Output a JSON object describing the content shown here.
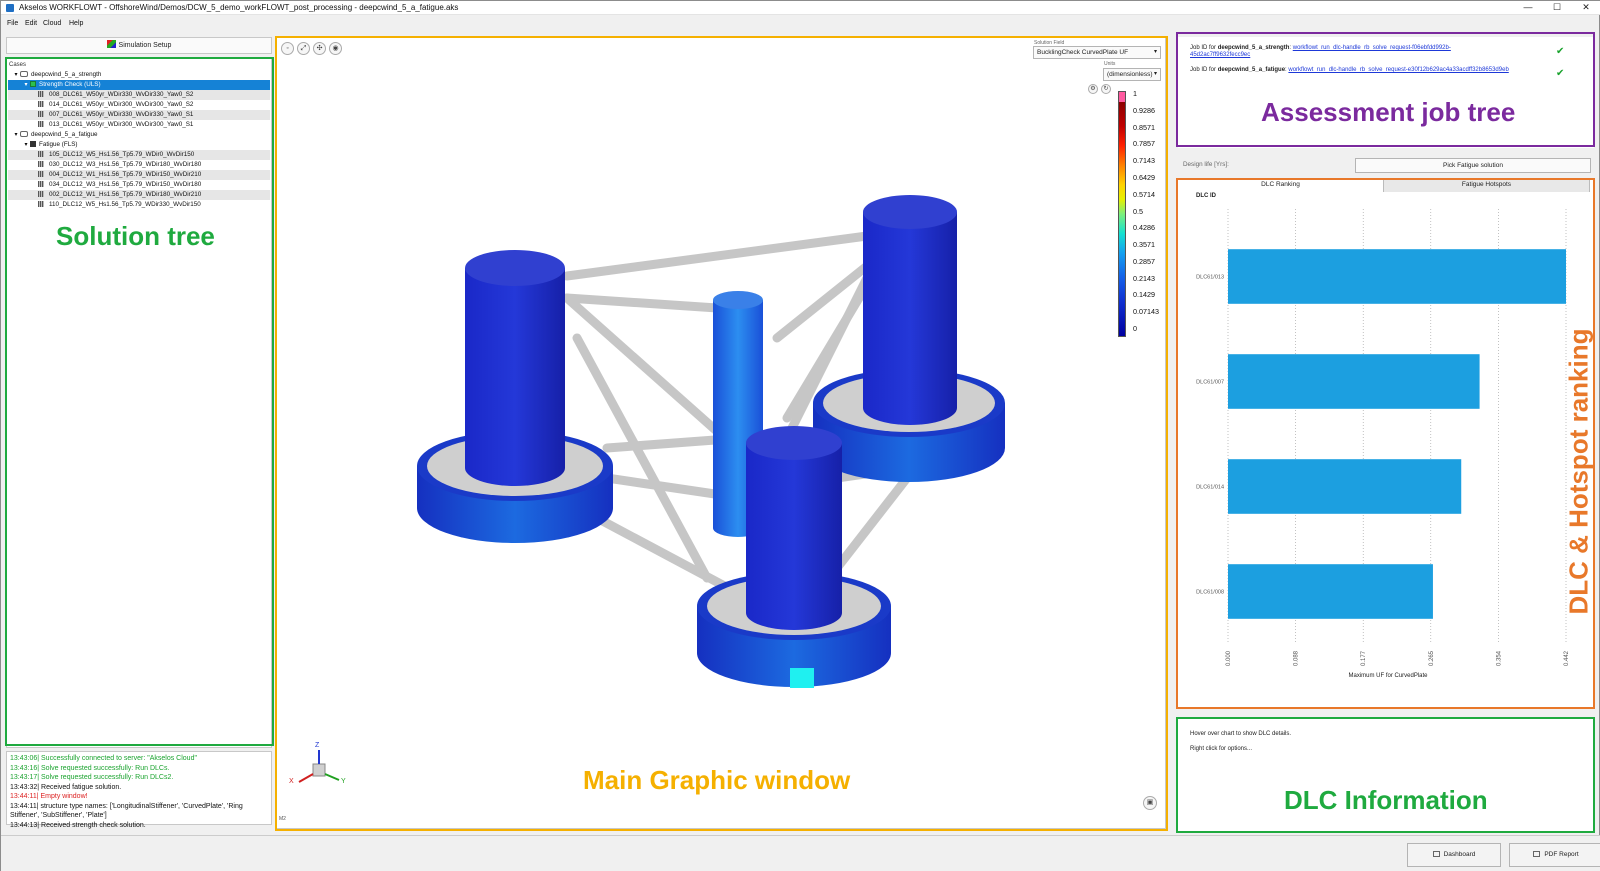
{
  "window": {
    "title": "Akselos WORKFLOWT - OffshoreWind/Demos/DCW_5_demo_workFLOWT_post_processing - deepcwind_5_a_fatigue.aks",
    "controls": [
      "—",
      "☐",
      "✕"
    ]
  },
  "menu": [
    "File",
    "Edit",
    "Cloud",
    "Help"
  ],
  "left": {
    "sim_setup_label": "Simulation Setup",
    "cases_header": "Cases",
    "tree": [
      {
        "label": "deepcwind_5_a_strength",
        "kind": "case",
        "expanded": true
      },
      {
        "label": "Strength Check (ULS)",
        "kind": "check",
        "selected": true
      },
      {
        "label": "008_DLC61_W50yr_WDir330_WvDir330_Yaw0_S2",
        "kind": "dlc"
      },
      {
        "label": "014_DLC61_W50yr_WDir300_WvDir300_Yaw0_S2",
        "kind": "dlc"
      },
      {
        "label": "007_DLC61_W50yr_WDir330_WvDir330_Yaw0_S1",
        "kind": "dlc"
      },
      {
        "label": "013_DLC61_W50yr_WDir300_WvDir300_Yaw0_S1",
        "kind": "dlc"
      },
      {
        "label": "deepcwind_5_a_fatigue",
        "kind": "case",
        "expanded": true
      },
      {
        "label": "Fatigue (FLS)",
        "kind": "fatigue"
      },
      {
        "label": "105_DLC12_W5_Hs1.56_Tp5.79_WDir0_WvDir150",
        "kind": "dlc"
      },
      {
        "label": "030_DLC12_W3_Hs1.56_Tp5.79_WDir180_WvDir180",
        "kind": "dlc"
      },
      {
        "label": "004_DLC12_W1_Hs1.56_Tp5.79_WDir150_WvDir210",
        "kind": "dlc"
      },
      {
        "label": "034_DLC12_W3_Hs1.56_Tp5.79_WDir150_WvDir180",
        "kind": "dlc"
      },
      {
        "label": "002_DLC12_W1_Hs1.56_Tp5.79_WDir180_WvDir210",
        "kind": "dlc"
      },
      {
        "label": "110_DLC12_W5_Hs1.56_Tp5.79_WDir330_WvDir150",
        "kind": "dlc"
      }
    ],
    "overlay_label": "Solution tree"
  },
  "log": [
    {
      "text": "13:43:06| Successfully connected to server: \"Akselos Cloud\"",
      "level": "ok"
    },
    {
      "text": "13:43:16| Solve requested successfully: Run DLCs.",
      "level": "ok"
    },
    {
      "text": "13:43:17| Solve requested successfully: Run DLCs2.",
      "level": "ok"
    },
    {
      "text": "13:43:32| Received fatigue solution.",
      "level": "info"
    },
    {
      "text": "13:44:11| Empty window!",
      "level": "err"
    },
    {
      "text": "13:44:11| structure type names: ['LongitudinalStiffener', 'CurvedPlate', 'Ring Stiffener', 'SubStiffener', 'Plate']",
      "level": "info"
    },
    {
      "text": "13:44:13| Received strength check solution.",
      "level": "info"
    }
  ],
  "viewport": {
    "solution_field_label": "Solution Field",
    "solution_field_value": "BucklingCheck CurvedPlate UF",
    "units_label": "Units",
    "units_value": "(dimensionless)",
    "colorbar_labels": [
      "1",
      "0.9286",
      "0.8571",
      "0.7857",
      "0.7143",
      "0.6429",
      "0.5714",
      "0.5",
      "0.4286",
      "0.3571",
      "0.2857",
      "0.2143",
      "0.1429",
      "0.07143",
      "0"
    ],
    "overlay_label": "Main Graphic window",
    "axes": {
      "x": "X",
      "y": "Y",
      "z": "Z"
    },
    "corner_text": "M2"
  },
  "jobs": {
    "lines": [
      {
        "prefix": "Job ID for ",
        "name": "deepcwind_5_a_strength",
        "sep": ": ",
        "link": "workflowt_run_dlc-handle_rb_solve_request-f06ebfdd992b-45d2ac7ff9632fecc9ec",
        "done": "✔"
      },
      {
        "prefix": "Job ID for ",
        "name": "deepcwind_5_a_fatigue",
        "sep": ": ",
        "link": "workflowt_run_dlc-handle_rb_solve_request-e30f12b629ac4a33acdff32b8653d9eb",
        "done": "✔"
      }
    ],
    "overlay_label": "Assessment job tree"
  },
  "design_life_label": "Design life [Yrs]:",
  "pick_button": "Pick Fatigue solution",
  "ranking": {
    "tabs": [
      "DLC Ranking",
      "Fatigue Hotspots"
    ],
    "overlay_label": "DLC & Hotspot ranking"
  },
  "chart_data": {
    "type": "bar",
    "orientation": "horizontal",
    "ylabel": "DLC ID",
    "xlabel": "Maximum UF for CurvedPlate",
    "categories": [
      "DLC61/013",
      "DLC61/007",
      "DLC61/014",
      "DLC61/008"
    ],
    "values": [
      0.442,
      0.329,
      0.305,
      0.268
    ],
    "xlim": [
      0,
      0.442
    ],
    "xticks": [
      "0.000",
      "0.088",
      "0.177",
      "0.265",
      "0.354",
      "0.442"
    ],
    "color": "#1c9fe0"
  },
  "info": {
    "lines": [
      "Hover over chart to show DLC details.",
      "Right click for options..."
    ],
    "overlay_label": "DLC Information"
  },
  "bottom": {
    "dashboard": "Dashboard",
    "pdf": "PDF Report"
  },
  "colors": {
    "green_frame": "#1faa3f",
    "amber_frame": "#f5b000",
    "purple_frame": "#7b2a9e",
    "orange_frame": "#e8782a",
    "selection": "#1582d6"
  }
}
